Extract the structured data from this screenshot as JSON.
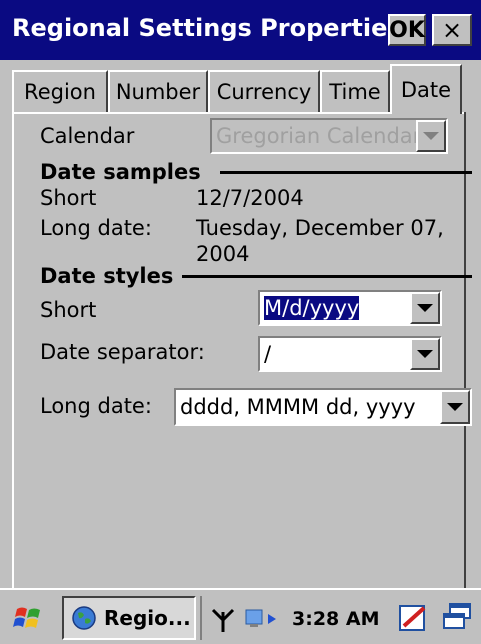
{
  "window": {
    "title": "Regional Settings Properties",
    "ok_label": "OK",
    "close_label": "×"
  },
  "tabs": [
    {
      "label": "Region",
      "active": false
    },
    {
      "label": "Number",
      "active": false
    },
    {
      "label": "Currency",
      "active": false
    },
    {
      "label": "Time",
      "active": false
    },
    {
      "label": "Date",
      "active": true
    }
  ],
  "calendar": {
    "label": "Calendar",
    "value": "Gregorian Calendar",
    "disabled": true
  },
  "date_samples": {
    "heading": "Date samples",
    "short_label": "Short",
    "short_value": "12/7/2004",
    "long_label": "Long date:",
    "long_value_line1": "Tuesday, December 07,",
    "long_value_line2": "2004"
  },
  "date_styles": {
    "heading": "Date styles",
    "short_label": "Short",
    "short_value": "M/d/yyyy",
    "separator_label": "Date separator:",
    "separator_value": "/",
    "long_label": "Long date:",
    "long_value": "dddd, MMMM dd, yyyy"
  },
  "taskbar": {
    "task_label": "Regio...",
    "time": "3:28 AM"
  },
  "icons": [
    "start-flag-icon",
    "globe-icon",
    "antenna-icon",
    "network-icon",
    "input-panel-icon",
    "switch-window-icon",
    "chevron-down-icon",
    "close-icon"
  ]
}
